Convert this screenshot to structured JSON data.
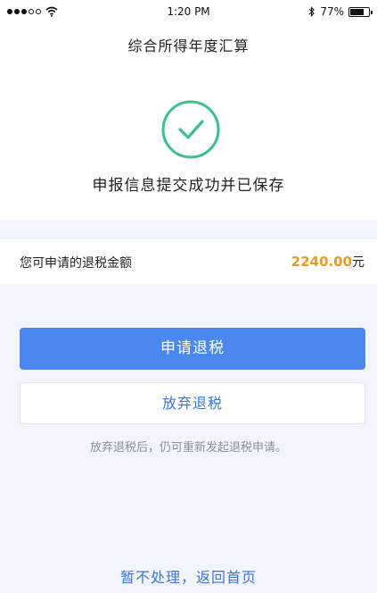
{
  "status_bar": {
    "time": "1:20 PM",
    "battery_percent": "77%",
    "battery_level": 0.77,
    "signal_bars_filled": 3,
    "signal_bars_total": 5,
    "icons": [
      "signal-icon",
      "wifi-icon",
      "bluetooth-icon",
      "battery-icon"
    ]
  },
  "header": {
    "title": "综合所得年度汇算"
  },
  "success": {
    "icon": "check-circle-icon",
    "message": "申报信息提交成功并已保存",
    "color": "#3cbf8a"
  },
  "refund": {
    "label": "您可申请的退税金额",
    "amount": "2240.00",
    "unit": "元",
    "amount_color": "#e89b22"
  },
  "actions": {
    "apply_label": "申请退税",
    "abandon_label": "放弃退税",
    "hint": "放弃退税后，仍可重新发起退税申请。",
    "primary_color": "#4a88f0"
  },
  "footer": {
    "home_link": "暂不处理，返回首页"
  }
}
